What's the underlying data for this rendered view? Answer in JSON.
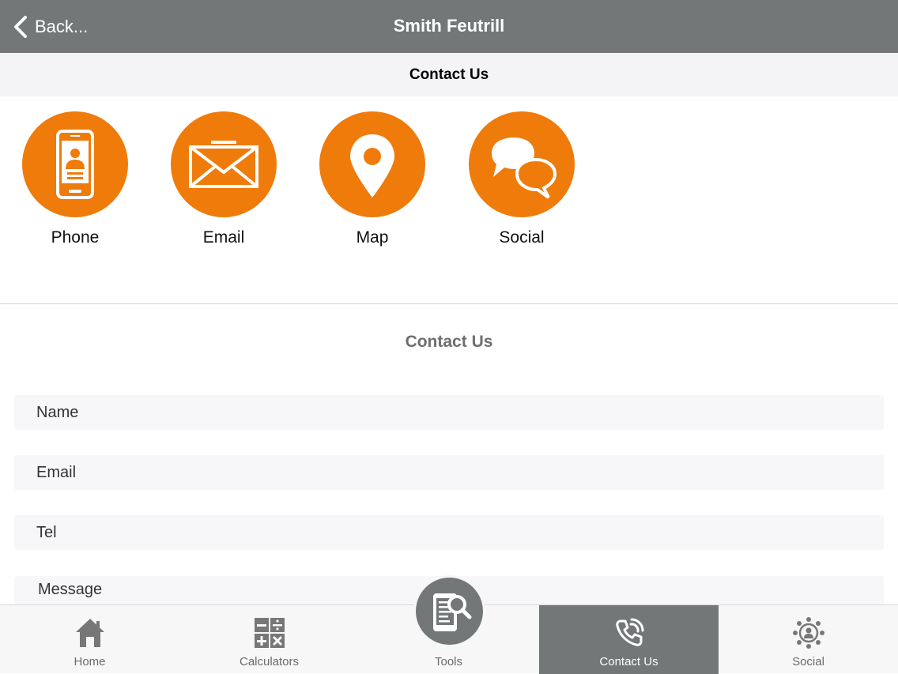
{
  "header": {
    "back_label": "Back...",
    "title": "Smith Feutrill"
  },
  "subheader": {
    "title": "Contact Us"
  },
  "tiles": [
    {
      "label": "Phone",
      "icon": "phone-icon"
    },
    {
      "label": "Email",
      "icon": "envelope-icon"
    },
    {
      "label": "Map",
      "icon": "map-pin-icon"
    },
    {
      "label": "Social",
      "icon": "chat-bubbles-icon"
    }
  ],
  "form": {
    "title": "Contact Us",
    "name_placeholder": "Name",
    "email_placeholder": "Email",
    "tel_placeholder": "Tel",
    "message_placeholder": "Message"
  },
  "tabbar": {
    "items": [
      {
        "label": "Home",
        "icon": "home-icon"
      },
      {
        "label": "Calculators",
        "icon": "calculator-icon"
      },
      {
        "label": "Tools",
        "icon": "tools-icon"
      },
      {
        "label": "Contact Us",
        "icon": "phone-call-icon",
        "active": true
      },
      {
        "label": "Social",
        "icon": "social-network-icon"
      }
    ]
  },
  "colors": {
    "nav_bar": "#737777",
    "accent": "#ef7b0b",
    "active_tab": "#737777",
    "subheader_bg": "#f4f4f6"
  }
}
